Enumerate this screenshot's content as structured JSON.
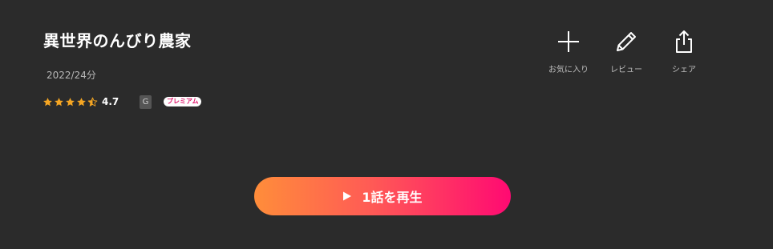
{
  "title": "異世界のんびり農家",
  "meta": "2022/24分",
  "rating": {
    "value": "4.7",
    "stars": 4.5
  },
  "age_rating": "G",
  "premium_label": "プレミアム",
  "actions": {
    "favorite": "お気に入り",
    "review": "レビュー",
    "share": "シェア"
  },
  "play_button": {
    "label": "1話を再生"
  },
  "icons": {
    "favorite": "plus-icon",
    "review": "pencil-icon",
    "share": "share-icon",
    "play": "play-icon",
    "star": "star-icon"
  },
  "colors": {
    "background": "#2b2b2b",
    "star": "#f5a623",
    "premium_text": "#e01a6e",
    "play_gradient_start": "#ff8d3a",
    "play_gradient_end": "#ff0a72"
  }
}
